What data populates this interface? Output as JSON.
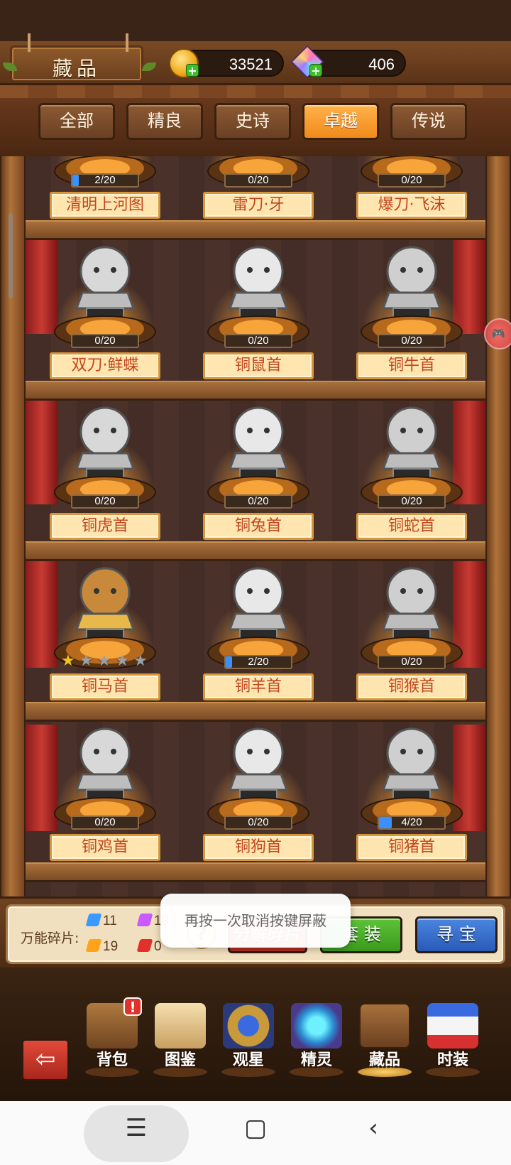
{
  "header": {
    "title": "藏品",
    "gold": "33521",
    "gems": "406"
  },
  "tabs": [
    {
      "label": "全部",
      "active": false
    },
    {
      "label": "精良",
      "active": false
    },
    {
      "label": "史诗",
      "active": false
    },
    {
      "label": "卓越",
      "active": true
    },
    {
      "label": "传说",
      "active": false
    }
  ],
  "items": [
    {
      "name": "清明上河图",
      "progress_text": "2/20",
      "progress": 0.1
    },
    {
      "name": "雷刀·牙",
      "progress_text": "0/20",
      "progress": 0
    },
    {
      "name": "爆刀·飞沫",
      "progress_text": "0/20",
      "progress": 0
    },
    {
      "name": "双刀·鲜蝶",
      "progress_text": "0/20",
      "progress": 0
    },
    {
      "name": "铜鼠首",
      "progress_text": "0/20",
      "progress": 0
    },
    {
      "name": "铜牛首",
      "progress_text": "0/20",
      "progress": 0
    },
    {
      "name": "铜虎首",
      "progress_text": "0/20",
      "progress": 0
    },
    {
      "name": "铜兔首",
      "progress_text": "0/20",
      "progress": 0
    },
    {
      "name": "铜蛇首",
      "progress_text": "0/20",
      "progress": 0
    },
    {
      "name": "铜马首",
      "stars": 1,
      "max_stars": 5
    },
    {
      "name": "铜羊首",
      "progress_text": "2/20",
      "progress": 0.1
    },
    {
      "name": "铜猴首",
      "progress_text": "0/20",
      "progress": 0
    },
    {
      "name": "铜鸡首",
      "progress_text": "0/20",
      "progress": 0
    },
    {
      "name": "铜狗首",
      "progress_text": "0/20",
      "progress": 0
    },
    {
      "name": "铜猪首",
      "progress_text": "4/20",
      "progress": 0.2
    }
  ],
  "fragments": {
    "label": "万能碎片:",
    "blue": "11",
    "purple": "19",
    "orange": "19",
    "red": "0"
  },
  "buttons": {
    "decompose": "分解碎片",
    "set": "套 装",
    "treasure": "寻 宝",
    "help": "?"
  },
  "toast": "再按一次取消按键屏蔽",
  "nav": [
    {
      "label": "背包",
      "badge": "!"
    },
    {
      "label": "图鉴"
    },
    {
      "label": "观星"
    },
    {
      "label": "精灵"
    },
    {
      "label": "藏品",
      "active": true
    },
    {
      "label": "时装"
    }
  ],
  "icons": {
    "exit": "exit-icon",
    "gold": "coin-icon",
    "gems": "gem-icon",
    "menu": "menu-icon",
    "home": "home-icon",
    "back": "back-icon"
  }
}
